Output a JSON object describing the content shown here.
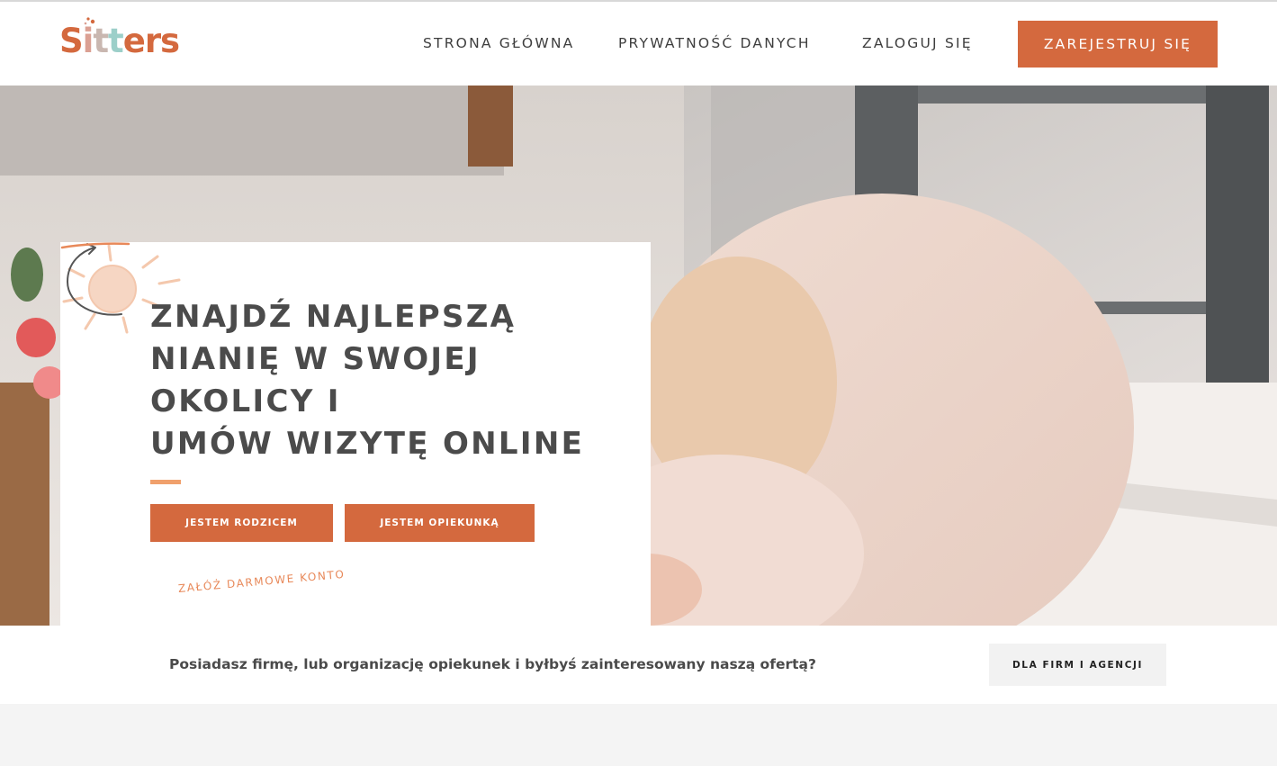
{
  "header": {
    "logo": {
      "parts": [
        "S",
        "i",
        "t",
        "t",
        "ers"
      ]
    },
    "nav": {
      "home": "STRONA GŁÓWNA",
      "privacy": "PRYWATNOŚĆ DANYCH",
      "login": "ZALOGUJ SIĘ"
    },
    "register_label": "ZAREJESTRUJ SIĘ"
  },
  "hero": {
    "headline_lines": [
      "ZNAJDŹ NAJLEPSZĄ",
      "NIANIĘ W SWOJEJ",
      "OKOLICY I",
      "UMÓW WIZYTĘ ONLINE"
    ],
    "parent_button": "JESTEM RODZICEM",
    "sitter_button": "JESTEM OPIEKUNKĄ",
    "free_account": "ZAŁÓŻ DARMOWE KONTO"
  },
  "business": {
    "question": "Posiadasz firmę, lub organizację opiekunek i byłbyś zainteresowany naszą ofertą?",
    "button": "DLA FIRM I AGENCJI"
  },
  "colors": {
    "accent": "#d4693e",
    "accent_light": "#f0a06c",
    "text_dark": "#4b4b4b",
    "logo_pink": "#dba093",
    "logo_teal": "#9ccfc9"
  },
  "icons": [
    "sun-doodle-icon",
    "curved-arrow-icon"
  ]
}
